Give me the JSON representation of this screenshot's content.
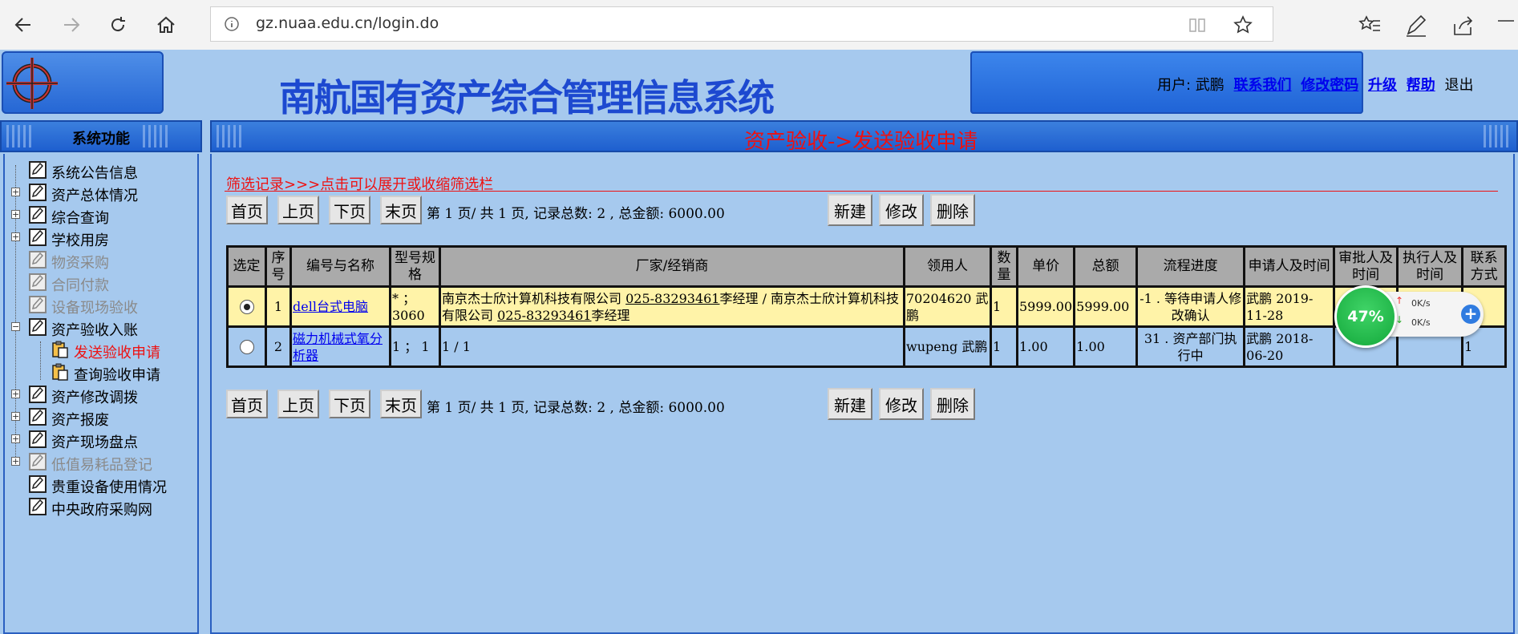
{
  "browser": {
    "url": "gz.nuaa.edu.cn/login.do"
  },
  "header": {
    "title": "南航国有资产综合管理信息系统",
    "user_label": "用户: 武鹏",
    "links": [
      "联系我们",
      "修改密码",
      "升级",
      "帮助"
    ],
    "exit": "退出"
  },
  "sidebar": {
    "title": "系统功能",
    "items": [
      {
        "label": "系统公告信息"
      },
      {
        "label": "资产总体情况"
      },
      {
        "label": "综合查询"
      },
      {
        "label": "学校用房"
      },
      {
        "label": "物资采购"
      },
      {
        "label": "合同付款"
      },
      {
        "label": "设备现场验收"
      },
      {
        "label": "资产验收入账"
      },
      {
        "label": "发送验收申请"
      },
      {
        "label": "查询验收申请"
      },
      {
        "label": "资产修改调拨"
      },
      {
        "label": "资产报废"
      },
      {
        "label": "资产现场盘点"
      },
      {
        "label": "低值易耗品登记"
      },
      {
        "label": "贵重设备使用情况"
      },
      {
        "label": "中央政府采购网"
      }
    ]
  },
  "main": {
    "breadcrumb": "资产验收->发送验收申请",
    "filter_title": "筛选记录>>>点击可以展开或收缩筛选栏",
    "pager": {
      "first": "首页",
      "prev": "上页",
      "next": "下页",
      "last": "末页",
      "info": "第 1 页/ 共 1 页, 记录总数: 2 , 总金额: 6000.00"
    },
    "actions": {
      "new": "新建",
      "edit": "修改",
      "delete": "删除"
    },
    "table": {
      "headers": [
        "选定",
        "序号",
        "编号与名称",
        "型号规格",
        "厂家/经销商",
        "领用人",
        "数量",
        "单价",
        "总额",
        "流程进度",
        "申请人及时间",
        "审批人及时间",
        "执行人及时间",
        "联系方式"
      ],
      "rows": [
        {
          "index": "1",
          "name": "dell台式电脑",
          "spec": "* ；3060",
          "vendor_a": "南京杰士欣计算机科技有限公司 ",
          "vendor_tel_a": "025-83293461",
          "vendor_b": "李经理 / 南京杰士欣计算机科技有限公司 ",
          "vendor_tel_b": "025-83293461",
          "vendor_c": "李经理",
          "user": "70204620 武鹏",
          "qty": "1",
          "unit_price": "5999.00",
          "total": "5999.00",
          "progress": "-1 . 等待申请人修改确认",
          "applicant": "武鹏 2019-11-28",
          "approver": "",
          "executor": "",
          "contact": ""
        },
        {
          "index": "2",
          "name": "磁力机械式氧分析器",
          "spec": "1 ； 1",
          "vendor": "1 / 1",
          "user": "wupeng 武鹏",
          "qty": "1",
          "unit_price": "1.00",
          "total": "1.00",
          "progress": "31 . 资产部门执行中",
          "applicant": "武鹏 2018-06-20",
          "approver": "",
          "executor": "",
          "contact": "1"
        }
      ]
    }
  },
  "speed_widget": {
    "percent": "47%",
    "up": "0K/s",
    "down": "0K/s"
  }
}
